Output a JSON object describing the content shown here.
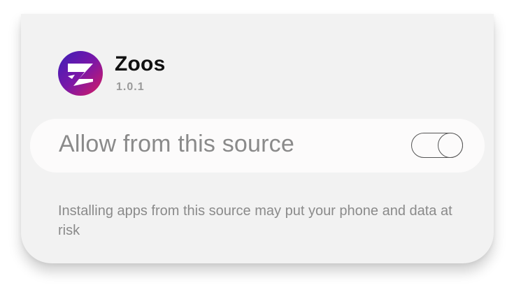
{
  "app": {
    "name": "Zoos",
    "version": "1.0.1",
    "icon": "zoos-logo-icon",
    "icon_colors": [
      "#3b1fb8",
      "#7a17a8",
      "#d81b60"
    ]
  },
  "setting": {
    "label": "Allow from this source",
    "toggle_state": "off"
  },
  "warning": {
    "text": "Installing apps from this source may put your phone and data at risk"
  }
}
